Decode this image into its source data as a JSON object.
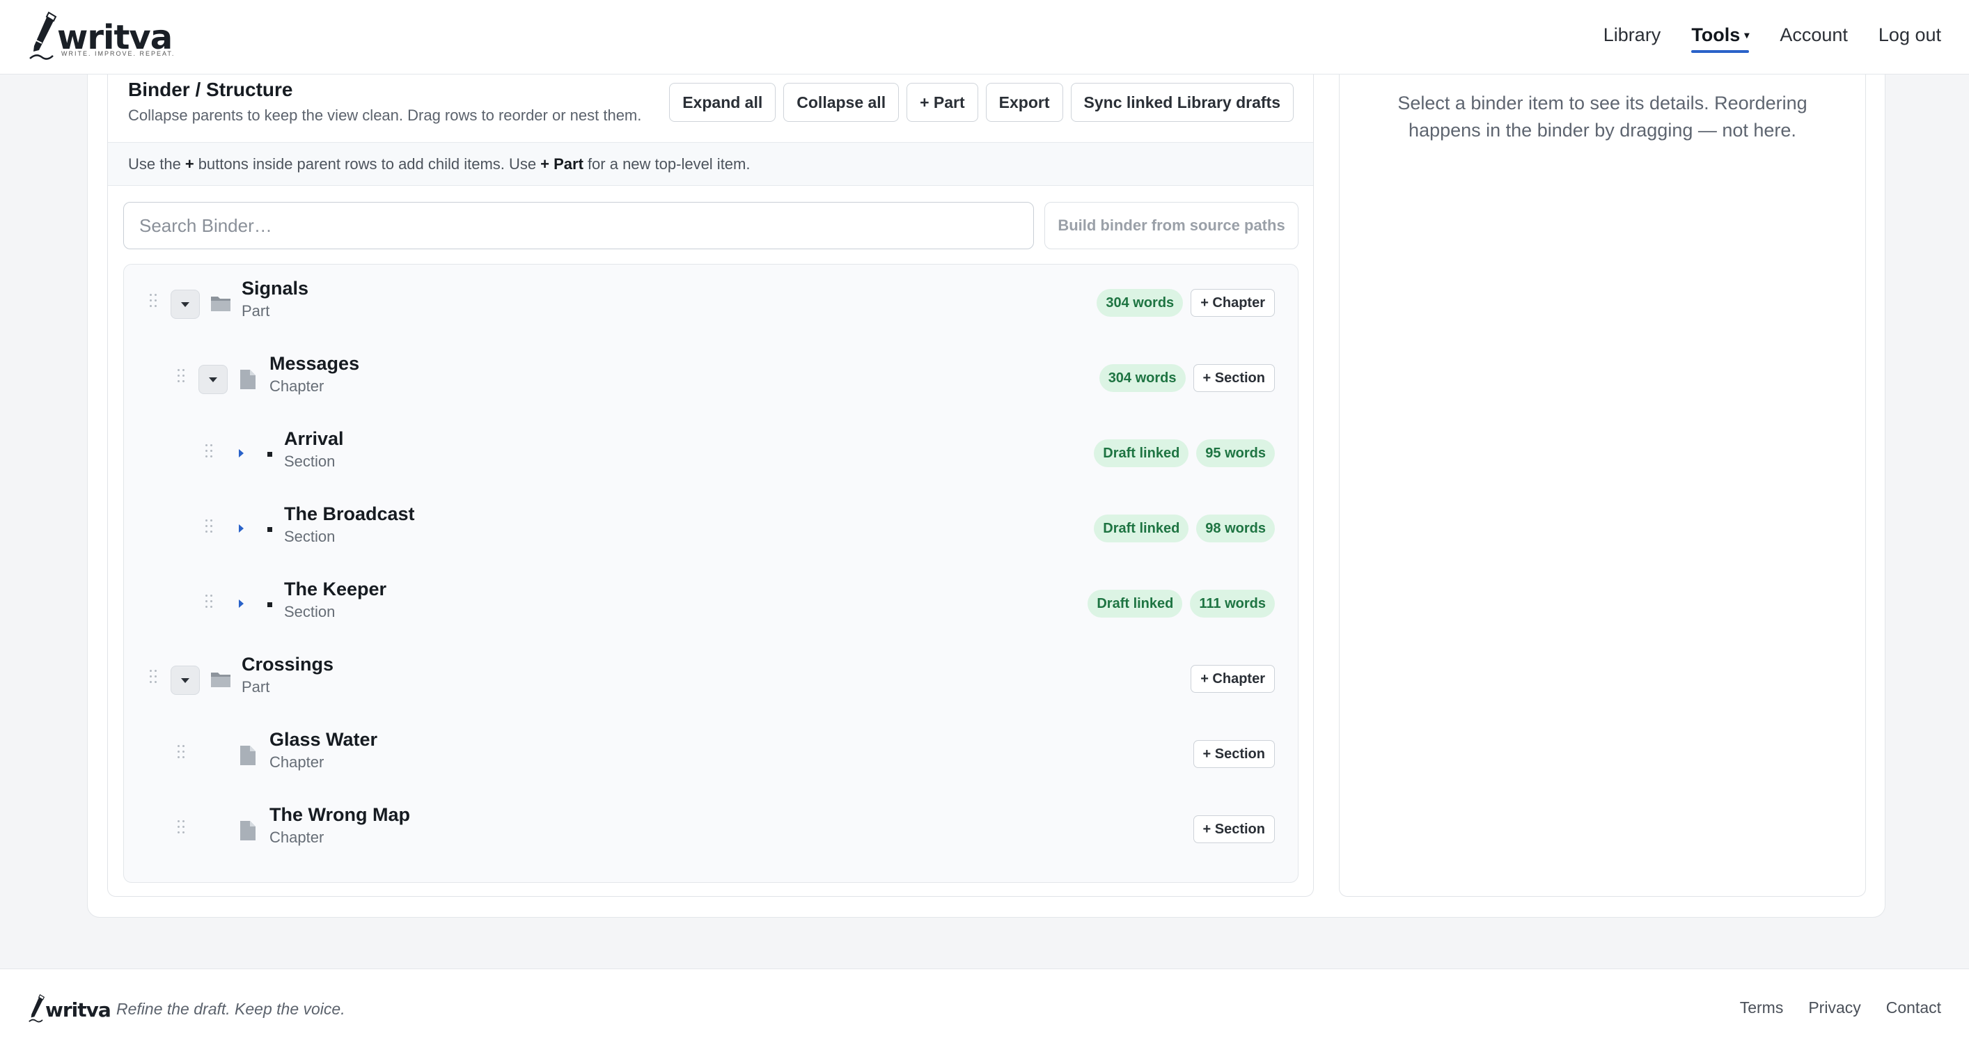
{
  "brand": {
    "name": "writva",
    "tagline": "WRITE. IMPROVE. REPEAT."
  },
  "nav": {
    "items": [
      "Library",
      "Tools",
      "Account",
      "Log out"
    ],
    "active": "Tools"
  },
  "binder": {
    "title": "Binder / Structure",
    "subtitle": "Collapse parents to keep the view clean. Drag rows to reorder or nest them.",
    "toolbar": {
      "expand_all": "Expand all",
      "collapse_all": "Collapse all",
      "add_part": "+ Part",
      "export": "Export",
      "sync": "Sync linked Library drafts"
    },
    "hint": {
      "p1": "Use the",
      "b1": "+",
      "p2": "buttons inside parent rows to add child items. Use",
      "b2": "+ Part",
      "p3": "for a new top-level item."
    },
    "search_placeholder": "Search Binder…",
    "build_button": "Build binder from source paths",
    "rows": [
      {
        "title": "Signals",
        "type": "Part",
        "badges": [
          "304 words"
        ],
        "action": "+ Chapter"
      },
      {
        "title": "Messages",
        "type": "Chapter",
        "badges": [
          "304 words"
        ],
        "action": "+ Section"
      },
      {
        "title": "Arrival",
        "type": "Section",
        "badges": [
          "Draft linked",
          "95 words"
        ],
        "action": ""
      },
      {
        "title": "The Broadcast",
        "type": "Section",
        "badges": [
          "Draft linked",
          "98 words"
        ],
        "action": ""
      },
      {
        "title": "The Keeper",
        "type": "Section",
        "badges": [
          "Draft linked",
          "111 words"
        ],
        "action": ""
      },
      {
        "title": "Crossings",
        "type": "Part",
        "badges": [],
        "action": "+ Chapter"
      },
      {
        "title": "Glass Water",
        "type": "Chapter",
        "badges": [],
        "action": "+ Section"
      },
      {
        "title": "The Wrong Map",
        "type": "Chapter",
        "badges": [],
        "action": "+ Section"
      }
    ]
  },
  "details": {
    "message": "Select a binder item to see its details. Reordering happens in the binder by dragging — not here."
  },
  "footer": {
    "tagline": "Refine the draft. Keep the voice.",
    "links": [
      "Terms",
      "Privacy",
      "Contact"
    ]
  },
  "colors": {
    "accent": "#2a62c9",
    "badge_bg": "#dcf4e4",
    "badge_text": "#1e7442"
  }
}
